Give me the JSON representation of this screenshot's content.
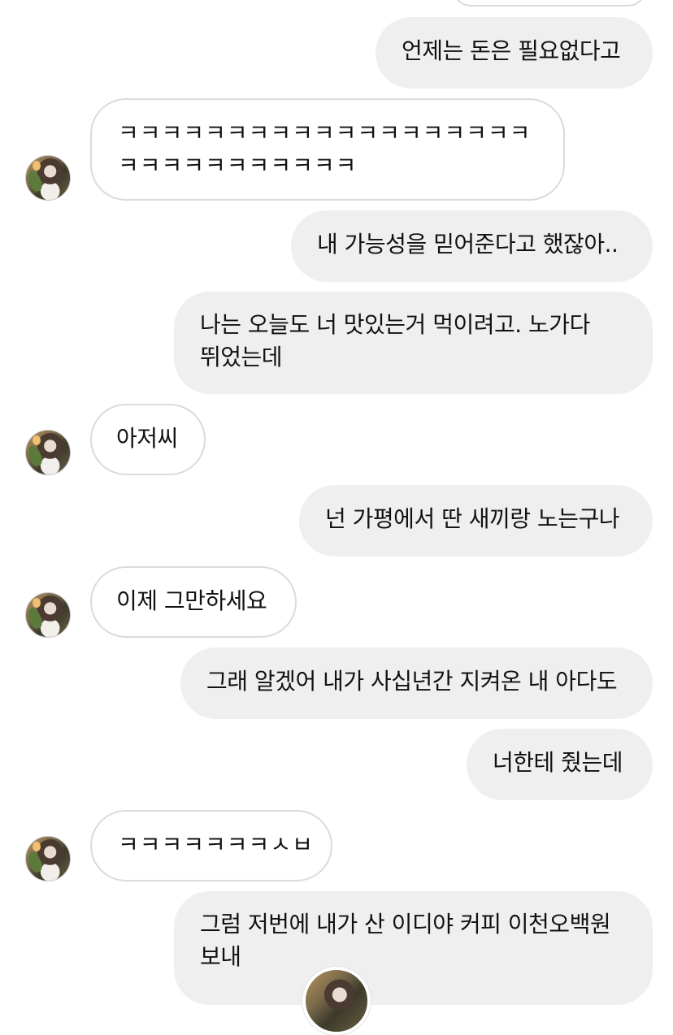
{
  "messages": [
    {
      "side": "sent",
      "text": "언제는 돈은 필요없다고"
    },
    {
      "side": "recv",
      "text": "ㅋㅋㅋㅋㅋㅋㅋㅋㅋㅋㅋㅋㅋㅋㅋㅋㅋㅋㅋㅋㅋㅋㅋㅋㅋㅋㅋㅋㅋㅋ"
    },
    {
      "side": "sent",
      "text": "내 가능성을 믿어준다고 했잖아.."
    },
    {
      "side": "sent",
      "text": "나는 오늘도 너 맛있는거 먹이려고. 노가다 뛰었는데"
    },
    {
      "side": "recv",
      "text": "아저씨"
    },
    {
      "side": "sent",
      "text": "넌 가평에서 딴 새끼랑 노는구나"
    },
    {
      "side": "recv",
      "text": "이제 그만하세요"
    },
    {
      "side": "sent",
      "text": "그래 알겠어 내가 사십년간 지켜온 내 아다도"
    },
    {
      "side": "sent",
      "text": "너한테 줬는데"
    },
    {
      "side": "recv",
      "text": "ㅋㅋㅋㅋㅋㅋㅋㅅㅂ"
    },
    {
      "side": "sent",
      "text": "그럼 저번에 내가 산 이디야 커피 이천오백원 보내"
    }
  ]
}
